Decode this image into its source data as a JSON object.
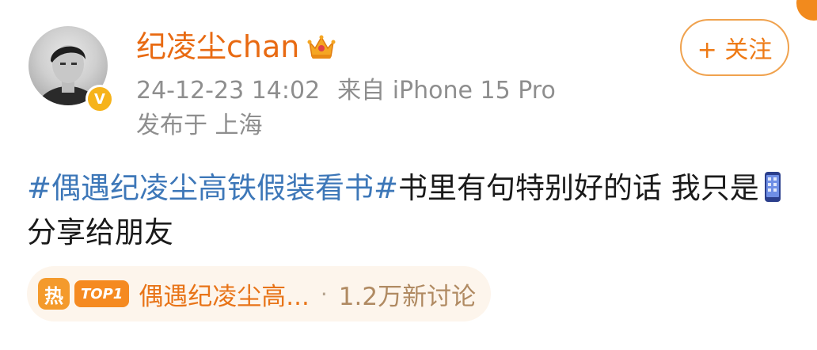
{
  "user": {
    "name": "纪凌尘chan",
    "verified_badge": "V",
    "crown_icon": "crown-icon"
  },
  "post_meta": {
    "time": "24-12-23 14:02",
    "source": "来自 iPhone 15 Pro",
    "location": "发布于 上海"
  },
  "follow_button": {
    "label": "+ 关注"
  },
  "post": {
    "hashtag": "#偶遇纪凌尘高铁假装看书#",
    "text_part1": "书里有句特别好的话  我只是",
    "text_part2": "分享给朋友",
    "emoji_icon": "phone-icon"
  },
  "topic": {
    "hot_label": "热",
    "rank_label": "TOP1",
    "title": "偶遇纪凌尘高...",
    "separator": "·",
    "discussion_count": "1.2万新讨论"
  },
  "colors": {
    "username": "#e86a12",
    "meta": "#8e8e8e",
    "hashtag": "#3d77b8",
    "topic_bg": "#fdf5ec",
    "accent": "#f58a21"
  }
}
